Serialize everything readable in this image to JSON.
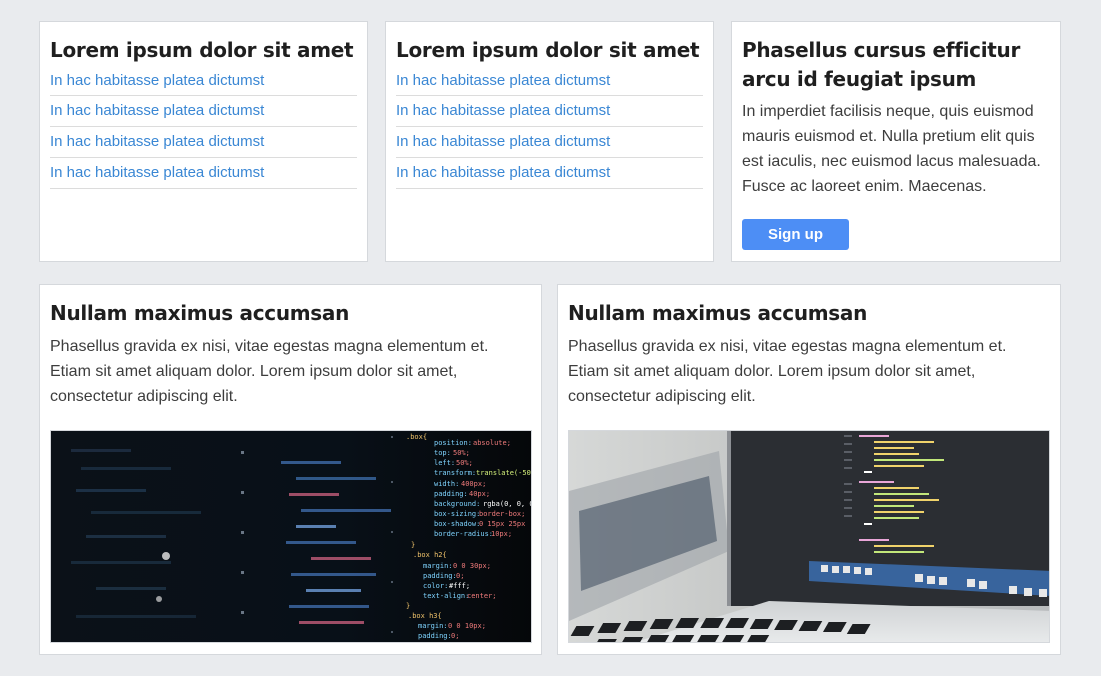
{
  "top_cards": [
    {
      "title": "Lorem ipsum dolor sit amet",
      "links": [
        "In hac habitasse platea dictumst",
        "In hac habitasse platea dictumst",
        "In hac habitasse platea dictumst",
        "In hac habitasse platea dictumst"
      ]
    },
    {
      "title": "Lorem ipsum dolor sit amet",
      "links": [
        "In hac habitasse platea dictumst",
        "In hac habitasse platea dictumst",
        "In hac habitasse platea dictumst",
        "In hac habitasse platea dictumst"
      ]
    },
    {
      "title": "Phasellus cursus efficitur arcu id feugiat ipsum",
      "text": "In imperdiet facilisis neque, quis euismod mauris euismod et. Nulla pretium elit quis est iaculis, nec euismod lacus malesuada. Fusce ac laoreet enim. Maecenas.",
      "button_label": "Sign up"
    }
  ],
  "bottom_cards": [
    {
      "title": "Nullam maximus accumsan",
      "text": "Phasellus gravida ex nisi, vitae egestas magna elementum et. Etiam sit amet aliquam dolor. Lorem ipsum dolor sit amet, consectetur adipiscing elit."
    },
    {
      "title": "Nullam maximus accumsan",
      "text": "Phasellus gravida ex nisi, vitae egestas magna elementum et. Etiam sit amet aliquam dolor. Lorem ipsum dolor sit amet, consectetur adipiscing elit."
    }
  ],
  "colors": {
    "page_background": "#e9ebee",
    "link": "#3a87d4",
    "button": "#4d8ef5"
  }
}
